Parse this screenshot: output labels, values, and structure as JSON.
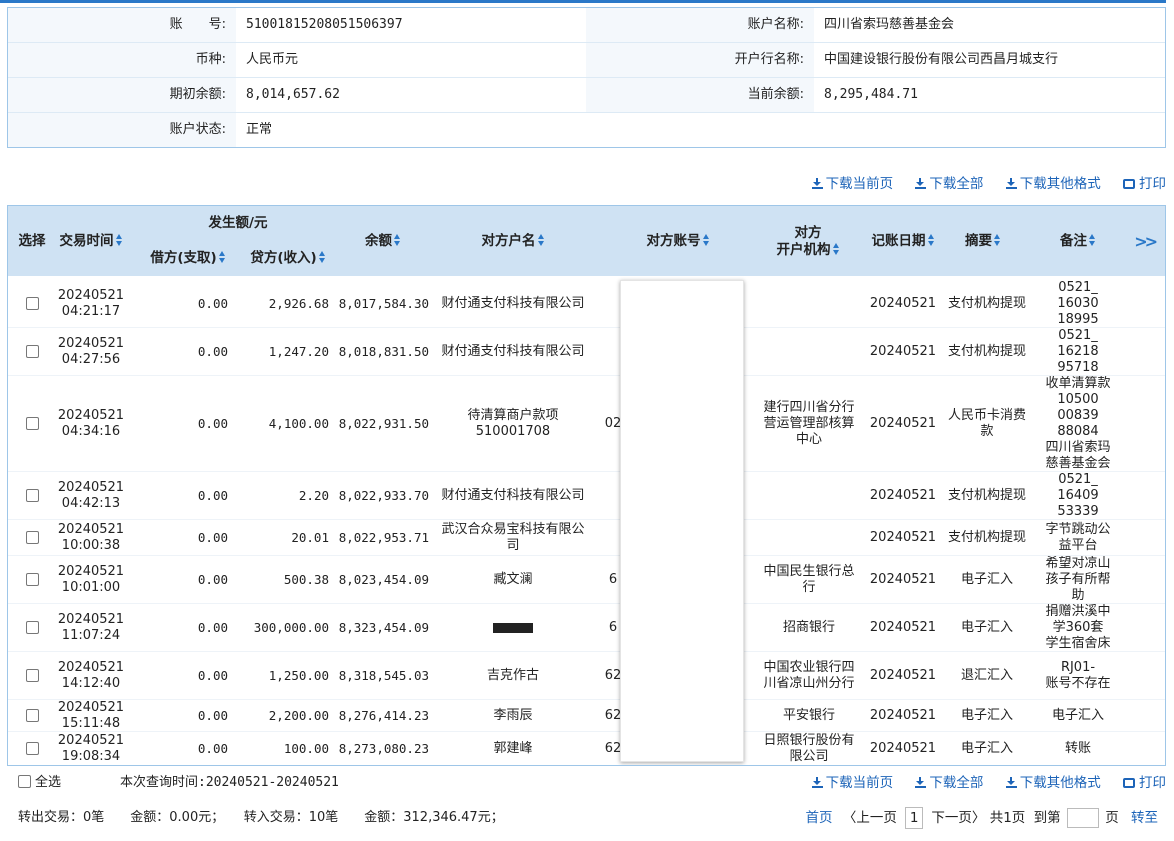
{
  "account": {
    "rows": [
      {
        "l1": "账　　号:",
        "v1": "51001815208051506397",
        "l2": "账户名称:",
        "v2": "四川省索玛慈善基金会"
      },
      {
        "l1": "币种:",
        "v1": "人民币元",
        "l2": "开户行名称:",
        "v2": "中国建设银行股份有限公司西昌月城支行"
      },
      {
        "l1": "期初余额:",
        "v1": "8,014,657.62",
        "l2": "当前余额:",
        "v2": "8,295,484.71"
      },
      {
        "l1": "账户状态:",
        "v1": "正常"
      }
    ]
  },
  "toolbar": {
    "download_page": "下载当前页",
    "download_all": "下载全部",
    "download_other": "下载其他格式",
    "print": "打印"
  },
  "table": {
    "headers": {
      "select": "选择",
      "time": "交易时间",
      "amount_group": "发生额/元",
      "debit": "借方(支取)",
      "credit": "贷方(收入)",
      "balance": "余额",
      "counterparty": "对方户名",
      "cp_account": "对方账号",
      "cp_bank_l1": "对方",
      "cp_bank_l2": "开户机构",
      "book_date": "记账日期",
      "summary": "摘要",
      "remark": "备注",
      "more": ">>"
    },
    "rows": [
      {
        "time": "20240521\n04:21:17",
        "debit": "0.00",
        "credit": "2,926.68",
        "balance": "8,017,584.30",
        "party": "财付通支付科技有限公司",
        "acct": "",
        "bank": "",
        "date": "20240521",
        "summary": "支付机构提现",
        "remark": "0521_\n16030\n18995"
      },
      {
        "time": "20240521\n04:27:56",
        "debit": "0.00",
        "credit": "1,247.20",
        "balance": "8,018,831.50",
        "party": "财付通支付科技有限公司",
        "acct": "",
        "bank": "",
        "date": "20240521",
        "summary": "支付机构提现",
        "remark": "0521_\n16218\n95718"
      },
      {
        "time": "20240521\n04:34:16",
        "debit": "0.00",
        "credit": "4,100.00",
        "balance": "8,022,931.50",
        "party": "待清算商户款项510001708",
        "acct": "02",
        "bank": "建行四川省分行营运管理部核算中心",
        "date": "20240521",
        "summary": "人民币卡消费款",
        "remark": "收单清算款\n10500\n00839\n88084\n四川省索玛\n慈善基金会"
      },
      {
        "time": "20240521\n04:42:13",
        "debit": "0.00",
        "credit": "2.20",
        "balance": "8,022,933.70",
        "party": "财付通支付科技有限公司",
        "acct": "",
        "bank": "",
        "date": "20240521",
        "summary": "支付机构提现",
        "remark": "0521_\n16409\n53339"
      },
      {
        "time": "20240521\n10:00:38",
        "debit": "0.00",
        "credit": "20.01",
        "balance": "8,022,953.71",
        "party": "武汉合众易宝科技有限公司",
        "acct": "",
        "bank": "",
        "date": "20240521",
        "summary": "支付机构提现",
        "remark": "字节跳动公\n益平台"
      },
      {
        "time": "20240521\n10:01:00",
        "debit": "0.00",
        "credit": "500.38",
        "balance": "8,023,454.09",
        "party": "臧文澜",
        "acct": "6",
        "bank": "中国民生银行总行",
        "date": "20240521",
        "summary": "电子汇入",
        "remark": "希望对凉山\n孩子有所帮\n助"
      },
      {
        "time": "20240521\n11:07:24",
        "debit": "0.00",
        "credit": "300,000.00",
        "balance": "8,323,454.09",
        "party": "",
        "acct": "6",
        "bank": "招商银行",
        "date": "20240521",
        "summary": "电子汇入",
        "remark": "捐赠洪溪中\n学360套\n学生宿舍床"
      },
      {
        "time": "20240521\n14:12:40",
        "debit": "0.00",
        "credit": "1,250.00",
        "balance": "8,318,545.03",
        "party": "吉克作古",
        "acct": "62",
        "bank": "中国农业银行四川省凉山州分行",
        "date": "20240521",
        "summary": "退汇汇入",
        "remark": "RJ01-\n账号不存在"
      },
      {
        "time": "20240521\n15:11:48",
        "debit": "0.00",
        "credit": "2,200.00",
        "balance": "8,276,414.23",
        "party": "李雨辰",
        "acct": "62",
        "bank": "平安银行",
        "date": "20240521",
        "summary": "电子汇入",
        "remark": "电子汇入"
      },
      {
        "time": "20240521\n19:08:34",
        "debit": "0.00",
        "credit": "100.00",
        "balance": "8,273,080.23",
        "party": "郭建峰",
        "acct": "62",
        "bank": "日照银行股份有限公司",
        "date": "20240521",
        "summary": "电子汇入",
        "remark": "转账"
      }
    ]
  },
  "footer": {
    "select_all": "全选",
    "query_time": "本次查询时间:20240521-20240521",
    "stats": "转出交易：0笔　　金额：0.00元；　　转入交易：10笔　　金额：312,346.47元；",
    "first": "首页",
    "prev": "〈上一页",
    "page_no": "1",
    "next": "下一页〉",
    "total": "共1页",
    "goto": "到第",
    "page_unit": "页",
    "go": "转至"
  }
}
